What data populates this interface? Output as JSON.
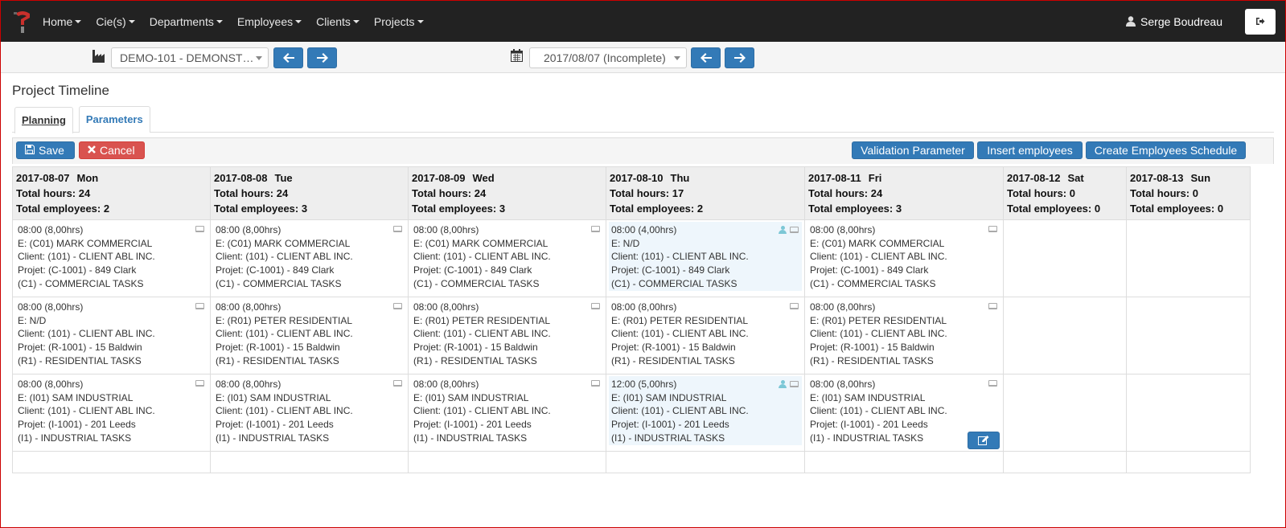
{
  "nav": {
    "items": [
      "Home",
      "Cie(s)",
      "Departments",
      "Employees",
      "Clients",
      "Projects"
    ],
    "user_name": "Serge Boudreau"
  },
  "toolbar": {
    "company_select": "DEMO-101 - DEMONST…",
    "date_select": "2017/08/07 (Incomplete)"
  },
  "page_title": "Project Timeline",
  "tabs": [
    {
      "label": "Planning",
      "active": true
    },
    {
      "label": "Parameters",
      "active": false
    }
  ],
  "actions": {
    "save": "Save",
    "cancel": "Cancel",
    "validation_parameter": "Validation Parameter",
    "insert_employees": "Insert employees",
    "create_schedule": "Create Employees Schedule"
  },
  "days": [
    {
      "date": "2017-08-07",
      "dow": "Mon",
      "hours": "Total hours: 24",
      "employees": "Total employees: 2"
    },
    {
      "date": "2017-08-08",
      "dow": "Tue",
      "hours": "Total hours: 24",
      "employees": "Total employees: 3"
    },
    {
      "date": "2017-08-09",
      "dow": "Wed",
      "hours": "Total hours: 24",
      "employees": "Total employees: 3"
    },
    {
      "date": "2017-08-10",
      "dow": "Thu",
      "hours": "Total hours: 17",
      "employees": "Total employees: 2"
    },
    {
      "date": "2017-08-11",
      "dow": "Fri",
      "hours": "Total hours: 24",
      "employees": "Total employees: 3"
    },
    {
      "date": "2017-08-12",
      "dow": "Sat",
      "hours": "Total hours: 0",
      "employees": "Total employees: 0"
    },
    {
      "date": "2017-08-13",
      "dow": "Sun",
      "hours": "Total hours: 0",
      "employees": "Total employees: 0"
    }
  ],
  "rows": [
    [
      {
        "time": "08:00 (8,00hrs)",
        "emp": "E: (C01) MARK COMMERCIAL",
        "client": "Client: (101) - CLIENT ABL INC.",
        "project": "Projet: (C-1001) - 849 Clark",
        "task": "(C1) - COMMERCIAL TASKS",
        "hl": false
      },
      {
        "time": "08:00 (8,00hrs)",
        "emp": "E: (C01) MARK COMMERCIAL",
        "client": "Client: (101) - CLIENT ABL INC.",
        "project": "Projet: (C-1001) - 849 Clark",
        "task": "(C1) - COMMERCIAL TASKS",
        "hl": false
      },
      {
        "time": "08:00 (8,00hrs)",
        "emp": "E: (C01) MARK COMMERCIAL",
        "client": "Client: (101) - CLIENT ABL INC.",
        "project": "Projet: (C-1001) - 849 Clark",
        "task": "(C1) - COMMERCIAL TASKS",
        "hl": false
      },
      {
        "time": "08:00 (4,00hrs)",
        "emp": "E: N/D",
        "client": "Client: (101) - CLIENT ABL INC.",
        "project": "Projet: (C-1001) - 849 Clark",
        "task": "(C1) - COMMERCIAL TASKS",
        "hl": true
      },
      {
        "time": "08:00 (8,00hrs)",
        "emp": "E: (C01) MARK COMMERCIAL",
        "client": "Client: (101) - CLIENT ABL INC.",
        "project": "Projet: (C-1001) - 849 Clark",
        "task": "(C1) - COMMERCIAL TASKS",
        "hl": false
      }
    ],
    [
      {
        "time": "08:00 (8,00hrs)",
        "emp": "E: N/D",
        "client": "Client: (101) - CLIENT ABL INC.",
        "project": "Projet: (R-1001) - 15 Baldwin",
        "task": "(R1) - RESIDENTIAL TASKS",
        "hl": false
      },
      {
        "time": "08:00 (8,00hrs)",
        "emp": "E: (R01) PETER RESIDENTIAL",
        "client": "Client: (101) - CLIENT ABL INC.",
        "project": "Projet: (R-1001) - 15 Baldwin",
        "task": "(R1) - RESIDENTIAL TASKS",
        "hl": false
      },
      {
        "time": "08:00 (8,00hrs)",
        "emp": "E: (R01) PETER RESIDENTIAL",
        "client": "Client: (101) - CLIENT ABL INC.",
        "project": "Projet: (R-1001) - 15 Baldwin",
        "task": "(R1) - RESIDENTIAL TASKS",
        "hl": false
      },
      {
        "time": "08:00 (8,00hrs)",
        "emp": "E: (R01) PETER RESIDENTIAL",
        "client": "Client: (101) - CLIENT ABL INC.",
        "project": "Projet: (R-1001) - 15 Baldwin",
        "task": "(R1) - RESIDENTIAL TASKS",
        "hl": false
      },
      {
        "time": "08:00 (8,00hrs)",
        "emp": "E: (R01) PETER RESIDENTIAL",
        "client": "Client: (101) - CLIENT ABL INC.",
        "project": "Projet: (R-1001) - 15 Baldwin",
        "task": "(R1) - RESIDENTIAL TASKS",
        "hl": false
      }
    ],
    [
      {
        "time": "08:00 (8,00hrs)",
        "emp": "E: (I01) SAM INDUSTRIAL",
        "client": "Client: (101) - CLIENT ABL INC.",
        "project": "Projet: (I-1001) - 201 Leeds",
        "task": "(I1) - INDUSTRIAL TASKS",
        "hl": false
      },
      {
        "time": "08:00 (8,00hrs)",
        "emp": "E: (I01) SAM INDUSTRIAL",
        "client": "Client: (101) - CLIENT ABL INC.",
        "project": "Projet: (I-1001) - 201 Leeds",
        "task": "(I1) - INDUSTRIAL TASKS",
        "hl": false
      },
      {
        "time": "08:00 (8,00hrs)",
        "emp": "E: (I01) SAM INDUSTRIAL",
        "client": "Client: (101) - CLIENT ABL INC.",
        "project": "Projet: (I-1001) - 201 Leeds",
        "task": "(I1) - INDUSTRIAL TASKS",
        "hl": false
      },
      {
        "time": "12:00 (5,00hrs)",
        "emp": "E: (I01) SAM INDUSTRIAL",
        "client": "Client: (101) - CLIENT ABL INC.",
        "project": "Projet: (I-1001) - 201 Leeds",
        "task": "(I1) - INDUSTRIAL TASKS",
        "hl": true
      },
      {
        "time": "08:00 (8,00hrs)",
        "emp": "E: (I01) SAM INDUSTRIAL",
        "client": "Client: (101) - CLIENT ABL INC.",
        "project": "Projet: (I-1001) - 201 Leeds",
        "task": "(I1) - INDUSTRIAL TASKS",
        "hl": false,
        "edit": true
      }
    ]
  ],
  "colors": {
    "navbar": "#222222",
    "primary": "#337ab7",
    "danger": "#d9534f",
    "highlight": "#eef6fc"
  }
}
